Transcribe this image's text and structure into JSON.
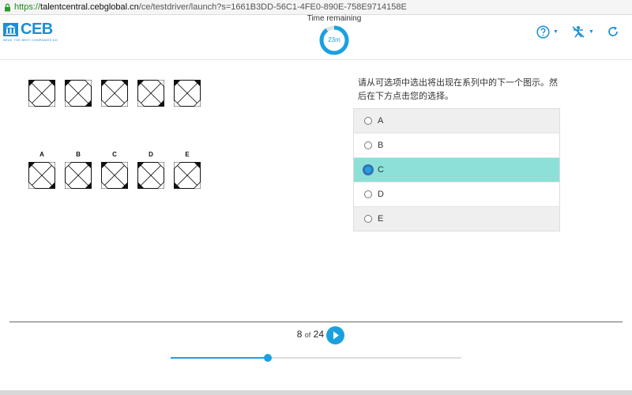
{
  "browser": {
    "url_scheme": "https://",
    "url_host": "talentcentral.cebglobal.cn",
    "url_path": "/ce/testdriver/launch?s=1661B3DD-56C1-4FE0-890E-758E9714158E"
  },
  "brand": {
    "name": "CEB",
    "tagline": "WHAT THE BEST COMPANIES DO"
  },
  "timer": {
    "label": "Time remaining",
    "value": "23m",
    "remaining_fraction": 0.9
  },
  "header_icons": [
    "help-icon",
    "accessibility-icon",
    "refresh-icon"
  ],
  "question": {
    "prompt": "请从可选项中选出将出现在系列中的下一个图示。然后在下方点击您的选择。",
    "series_count": 5,
    "option_labels": [
      "A",
      "B",
      "C",
      "D",
      "E"
    ]
  },
  "choices": [
    {
      "label": "A",
      "selected": false
    },
    {
      "label": "B",
      "selected": false
    },
    {
      "label": "C",
      "selected": true
    },
    {
      "label": "D",
      "selected": false
    },
    {
      "label": "E",
      "selected": false
    }
  ],
  "pager": {
    "current": "8",
    "of_label": "of",
    "total": "24",
    "progress_fraction": 0.333
  },
  "colors": {
    "accent": "#1aa0e0",
    "brand": "#1a8fd8",
    "selected_row": "#8de0d8"
  }
}
